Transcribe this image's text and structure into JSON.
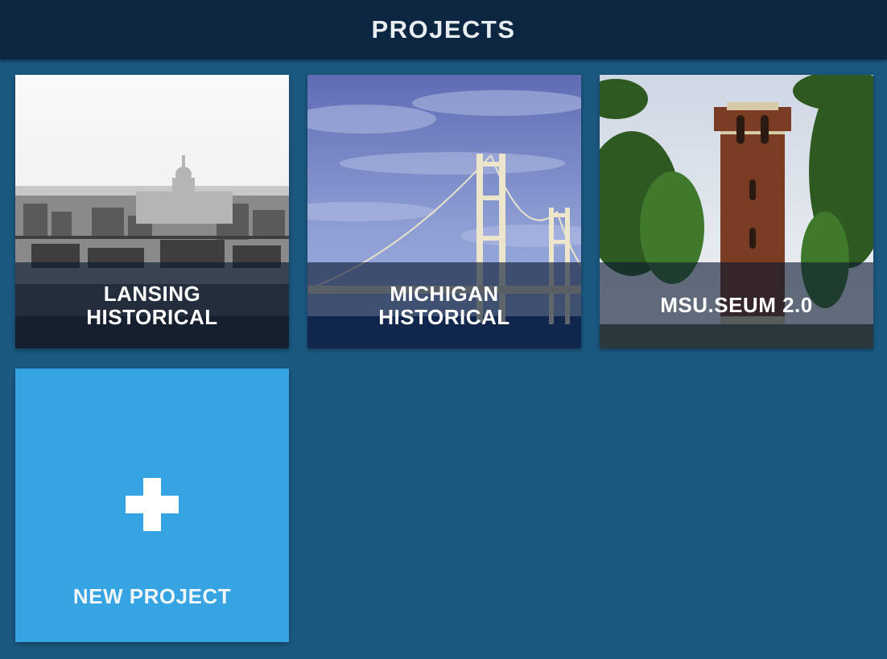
{
  "header": {
    "title": "PROJECTS"
  },
  "projects": [
    {
      "label": "LANSING\nHISTORICAL",
      "thumbnail": "historical-city-photo"
    },
    {
      "label": "MICHIGAN\nHISTORICAL",
      "thumbnail": "suspension-bridge-photo"
    },
    {
      "label": "MSU.SEUM 2.0",
      "thumbnail": "bell-tower-photo"
    }
  ],
  "new_project": {
    "label": "NEW PROJECT",
    "icon": "plus-icon"
  },
  "colors": {
    "background": "#1b5880",
    "header": "#0c2540",
    "new_tile": "#36a4e3"
  }
}
